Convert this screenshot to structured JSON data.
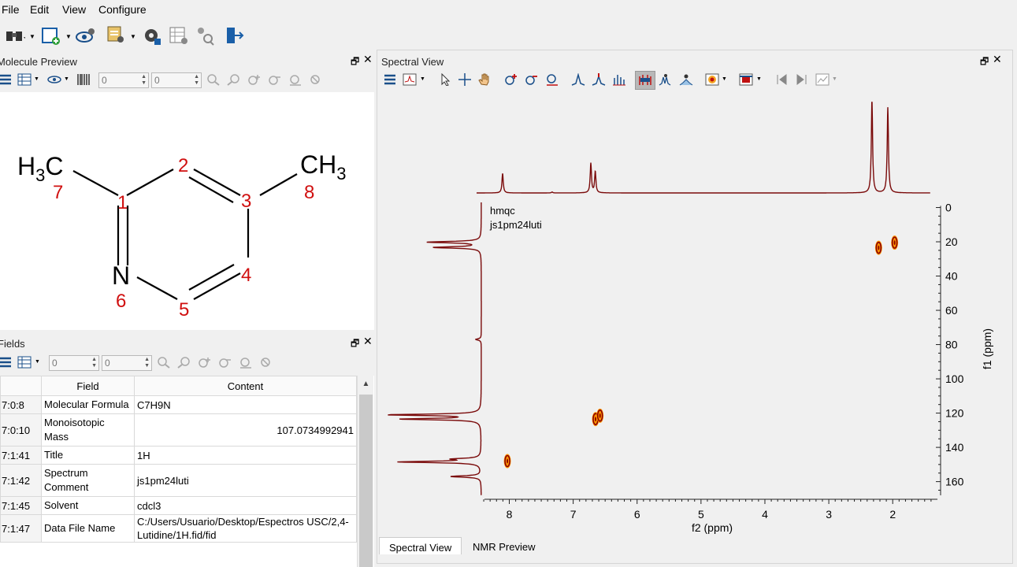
{
  "menu": [
    "File",
    "Edit",
    "View",
    "Configure"
  ],
  "molecule_panel": {
    "title": "Molecule Preview",
    "spin1": "0",
    "spin2": "0",
    "atoms": {
      "h3c": "H",
      "h3c_sub": "3",
      "h3c_c": "C",
      "ch3": "CH",
      "ch3_sub": "3",
      "n": "N"
    },
    "numbers": [
      "7",
      "1",
      "2",
      "3",
      "8",
      "4",
      "5",
      "6"
    ]
  },
  "fields_panel": {
    "title": "Fields",
    "spin1": "0",
    "spin2": "0",
    "headers": [
      "Field",
      "Content"
    ],
    "rows": [
      {
        "id": "7:0:8",
        "field": "Molecular Formula",
        "content": "C7H9N",
        "align": "left"
      },
      {
        "id": "7:0:10",
        "field": "Monoisotopic Mass",
        "content": "107.0734992941",
        "align": "right"
      },
      {
        "id": "7:1:41",
        "field": "Title",
        "content": "1H",
        "align": "left"
      },
      {
        "id": "7:1:42",
        "field": "Spectrum Comment",
        "content": "js1pm24luti",
        "align": "left"
      },
      {
        "id": "7:1:45",
        "field": "Solvent",
        "content": "cdcl3",
        "align": "left"
      },
      {
        "id": "7:1:47",
        "field": "Data File Name",
        "content": "C:/Users/Usuario/Desktop/Espectros USC/2,4-Lutidine/1H.fid/fid",
        "align": "left"
      }
    ]
  },
  "spectral_panel": {
    "title": "Spectral View",
    "label1": "hmqc",
    "label2": "js1pm24luti",
    "xlabel": "f2 (ppm)",
    "ylabel": "f1 (ppm)",
    "tabs": [
      "Spectral View",
      "NMR Preview"
    ]
  },
  "chart_data": {
    "type": "scatter",
    "subtype": "2d-nmr-hmqc",
    "xlabel": "f2 (ppm)",
    "ylabel": "f1 (ppm)",
    "x_ticks": [
      8,
      7,
      6,
      5,
      4,
      3,
      2
    ],
    "y_ticks": [
      0,
      20,
      40,
      60,
      80,
      100,
      120,
      140,
      160
    ],
    "xlim": [
      8.45,
      1.3
    ],
    "ylim": [
      -3,
      168
    ],
    "cross_peaks": [
      {
        "x": 2.22,
        "y": 23.5
      },
      {
        "x": 1.97,
        "y": 20.5
      },
      {
        "x": 6.65,
        "y": 123.5
      },
      {
        "x": 6.58,
        "y": 121.5
      },
      {
        "x": 8.03,
        "y": 148
      }
    ],
    "f2_projection_peaks": [
      {
        "x": 8.04,
        "h": 0.21
      },
      {
        "x": 7.26,
        "h": 0.01
      },
      {
        "x": 6.65,
        "h": 0.32
      },
      {
        "x": 6.58,
        "h": 0.23
      },
      {
        "x": 2.22,
        "h": 1.0
      },
      {
        "x": 1.97,
        "h": 0.92
      }
    ],
    "f1_projection_peaks": [
      {
        "y": 20.2,
        "h": 0.58
      },
      {
        "y": 23.3,
        "h": 0.51
      },
      {
        "y": 77.0,
        "h": 0.06
      },
      {
        "y": 121.0,
        "h": 0.98
      },
      {
        "y": 123.5,
        "h": 0.85
      },
      {
        "y": 146.8,
        "h": 0.27
      },
      {
        "y": 148.5,
        "h": 0.88
      },
      {
        "y": 157.0,
        "h": 0.33
      }
    ],
    "colors": {
      "line": "#7a0a0a",
      "contour_outer": "#ff9800",
      "contour_inner": "#8b0000"
    }
  }
}
